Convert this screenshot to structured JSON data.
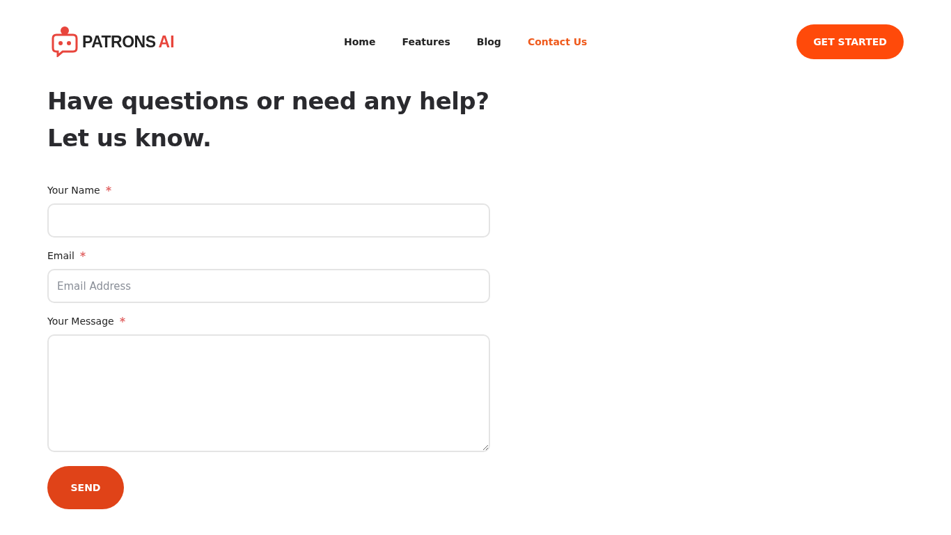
{
  "logo": {
    "name": "PATRONS",
    "accent": "AI"
  },
  "nav": [
    {
      "label": "Home",
      "selected": false
    },
    {
      "label": "Features",
      "selected": false
    },
    {
      "label": "Blog",
      "selected": false
    },
    {
      "label": "Contact Us",
      "selected": true
    }
  ],
  "cta": "GET STARTED",
  "heading": [
    "Have questions or need any help?",
    "Let us know."
  ],
  "fields": [
    {
      "kind": "input",
      "label": "Your Name",
      "required": true
    },
    {
      "kind": "input",
      "label": "Email",
      "required": true,
      "placeholder": "Email Address"
    },
    {
      "kind": "textarea",
      "label": "Your Message",
      "required": true
    }
  ],
  "submit": "SEND"
}
